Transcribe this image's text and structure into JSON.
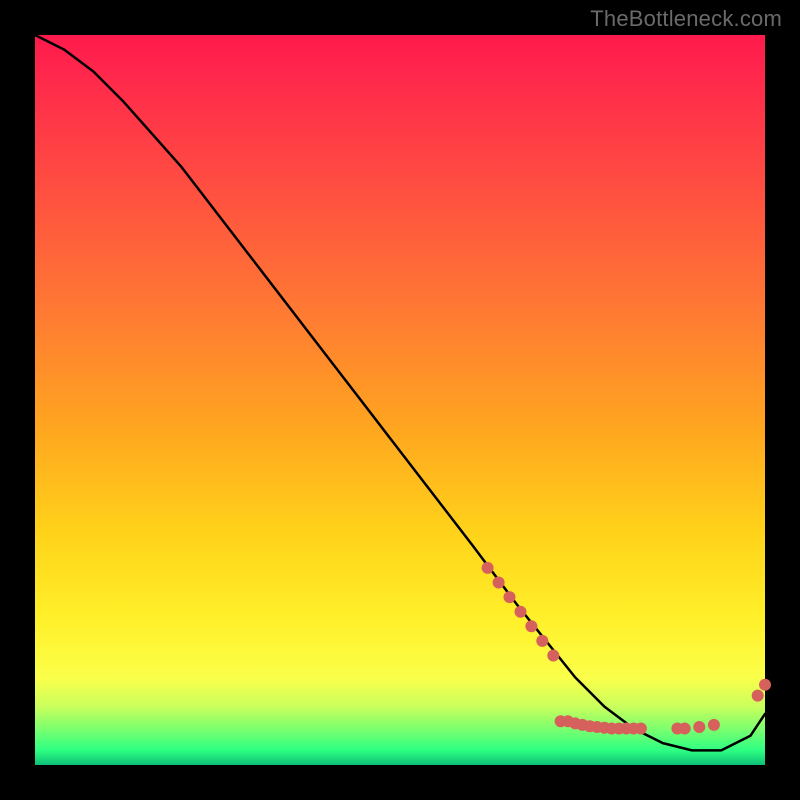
{
  "attribution": "TheBottleneck.com",
  "chart_data": {
    "type": "line",
    "title": "",
    "xlabel": "",
    "ylabel": "",
    "xlim": [
      0,
      100
    ],
    "ylim": [
      0,
      100
    ],
    "gradient_stops": [
      {
        "pct": 0,
        "color": "#ff1a4d"
      },
      {
        "pct": 8,
        "color": "#ff2e4a"
      },
      {
        "pct": 22,
        "color": "#ff5140"
      },
      {
        "pct": 38,
        "color": "#ff7a33"
      },
      {
        "pct": 54,
        "color": "#ffa61f"
      },
      {
        "pct": 68,
        "color": "#ffd21a"
      },
      {
        "pct": 80,
        "color": "#fff029"
      },
      {
        "pct": 88,
        "color": "#fbff4a"
      },
      {
        "pct": 92,
        "color": "#c9ff5c"
      },
      {
        "pct": 95,
        "color": "#7dff6e"
      },
      {
        "pct": 98,
        "color": "#2dff82"
      },
      {
        "pct": 100,
        "color": "#0dbf77"
      }
    ],
    "series": [
      {
        "name": "bottleneck-curve",
        "color": "#000000",
        "x": [
          0,
          4,
          8,
          12,
          20,
          30,
          40,
          50,
          60,
          66,
          70,
          74,
          78,
          82,
          86,
          90,
          94,
          98,
          100
        ],
        "y": [
          100,
          98,
          95,
          91,
          82,
          69,
          56,
          43,
          30,
          22,
          17,
          12,
          8,
          5,
          3,
          2,
          2,
          4,
          7
        ]
      }
    ],
    "markers": {
      "name": "highlight-points",
      "color": "#d6605b",
      "radius_px": 6,
      "points": [
        {
          "x": 62,
          "y": 27
        },
        {
          "x": 63.5,
          "y": 25
        },
        {
          "x": 65,
          "y": 23
        },
        {
          "x": 66.5,
          "y": 21
        },
        {
          "x": 68,
          "y": 19
        },
        {
          "x": 69.5,
          "y": 17
        },
        {
          "x": 71,
          "y": 15
        },
        {
          "x": 72,
          "y": 6
        },
        {
          "x": 73,
          "y": 6
        },
        {
          "x": 74,
          "y": 5.7
        },
        {
          "x": 75,
          "y": 5.5
        },
        {
          "x": 76,
          "y": 5.3
        },
        {
          "x": 77,
          "y": 5.2
        },
        {
          "x": 78,
          "y": 5.1
        },
        {
          "x": 79,
          "y": 5.0
        },
        {
          "x": 80,
          "y": 5.0
        },
        {
          "x": 81,
          "y": 5.0
        },
        {
          "x": 82,
          "y": 5.0
        },
        {
          "x": 83,
          "y": 5.0
        },
        {
          "x": 88,
          "y": 5.0
        },
        {
          "x": 89,
          "y": 5.0
        },
        {
          "x": 91,
          "y": 5.2
        },
        {
          "x": 93,
          "y": 5.5
        },
        {
          "x": 99,
          "y": 9.5
        },
        {
          "x": 100,
          "y": 11
        }
      ]
    }
  }
}
